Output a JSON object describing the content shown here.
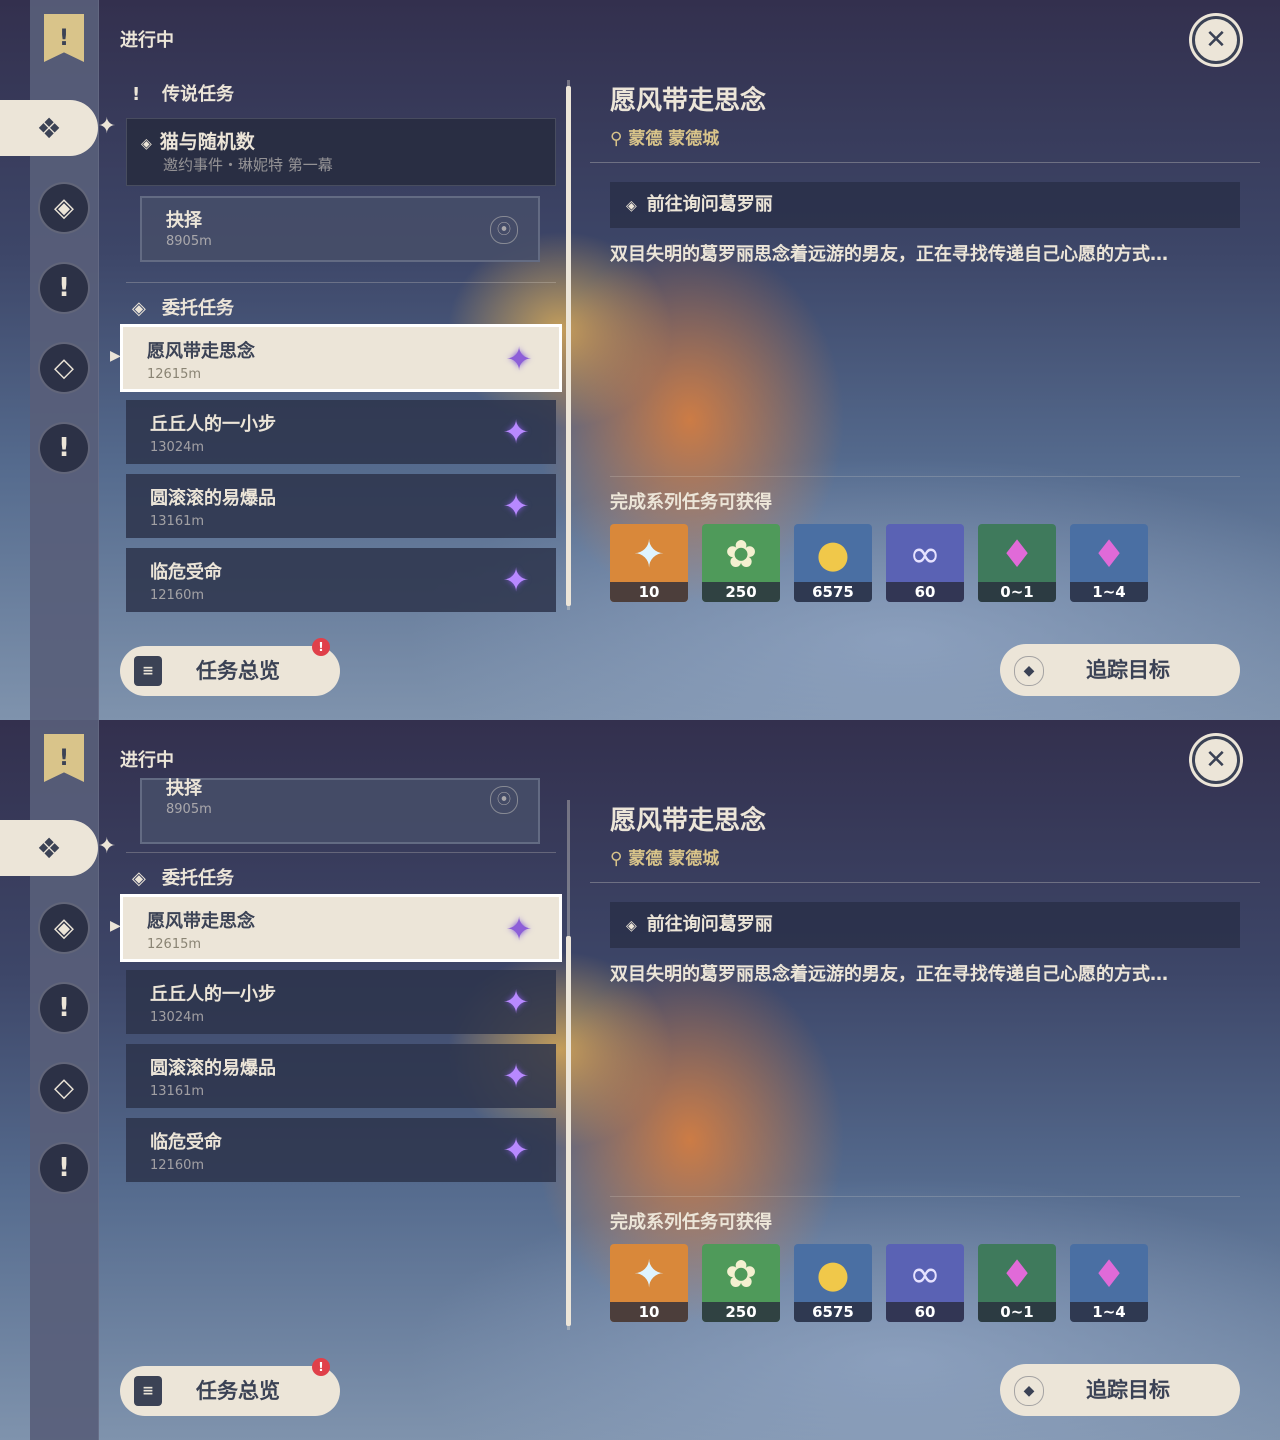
{
  "panels": [
    {
      "status_title": "进行中",
      "legend_section": "传说任务",
      "legend_quest": {
        "title": "猫与随机数",
        "subtitle": "邀约事件・琳妮特 第一幕"
      },
      "sub_quest": {
        "title": "抉择",
        "distance": "8905m"
      },
      "commission_section": "委托任务",
      "commissions": [
        {
          "title": "愿风带走思念",
          "distance": "12615m"
        },
        {
          "title": "丘丘人的一小步",
          "distance": "13024m"
        },
        {
          "title": "圆滚滚的易爆品",
          "distance": "13161m"
        },
        {
          "title": "临危受命",
          "distance": "12160m"
        }
      ]
    },
    {
      "status_title": "进行中",
      "sub_quest": {
        "title": "抉择",
        "distance": "8905m"
      },
      "commission_section": "委托任务",
      "commissions": [
        {
          "title": "愿风带走思念",
          "distance": "12615m"
        },
        {
          "title": "丘丘人的一小步",
          "distance": "13024m"
        },
        {
          "title": "圆滚滚的易爆品",
          "distance": "13161m"
        },
        {
          "title": "临危受命",
          "distance": "12160m"
        }
      ]
    }
  ],
  "detail": {
    "title": "愿风带走思念",
    "location": "蒙德 蒙德城",
    "objective": "前往询问葛罗丽",
    "description": "双目失明的葛罗丽思念着远游的男友，正在寻找传递自己心愿的方式…",
    "rewards_heading": "完成系列任务可获得",
    "rewards": [
      {
        "icon": "primogem-icon",
        "count": "10",
        "color": "#d9883a"
      },
      {
        "icon": "adventure-exp-icon",
        "count": "250",
        "color": "#4f9a5a"
      },
      {
        "icon": "mora-icon",
        "count": "6575",
        "color": "#4a6fa3"
      },
      {
        "icon": "companionship-exp-icon",
        "count": "60",
        "color": "#5a62b4"
      },
      {
        "icon": "ore-crystal-icon",
        "count": "0~1",
        "color": "#3f7a5c"
      },
      {
        "icon": "crystal-chunk-icon",
        "count": "1~4",
        "color": "#4a6fa3"
      }
    ]
  },
  "buttons": {
    "overview": "任务总览",
    "overview_badge": "!",
    "track": "追踪目标"
  }
}
